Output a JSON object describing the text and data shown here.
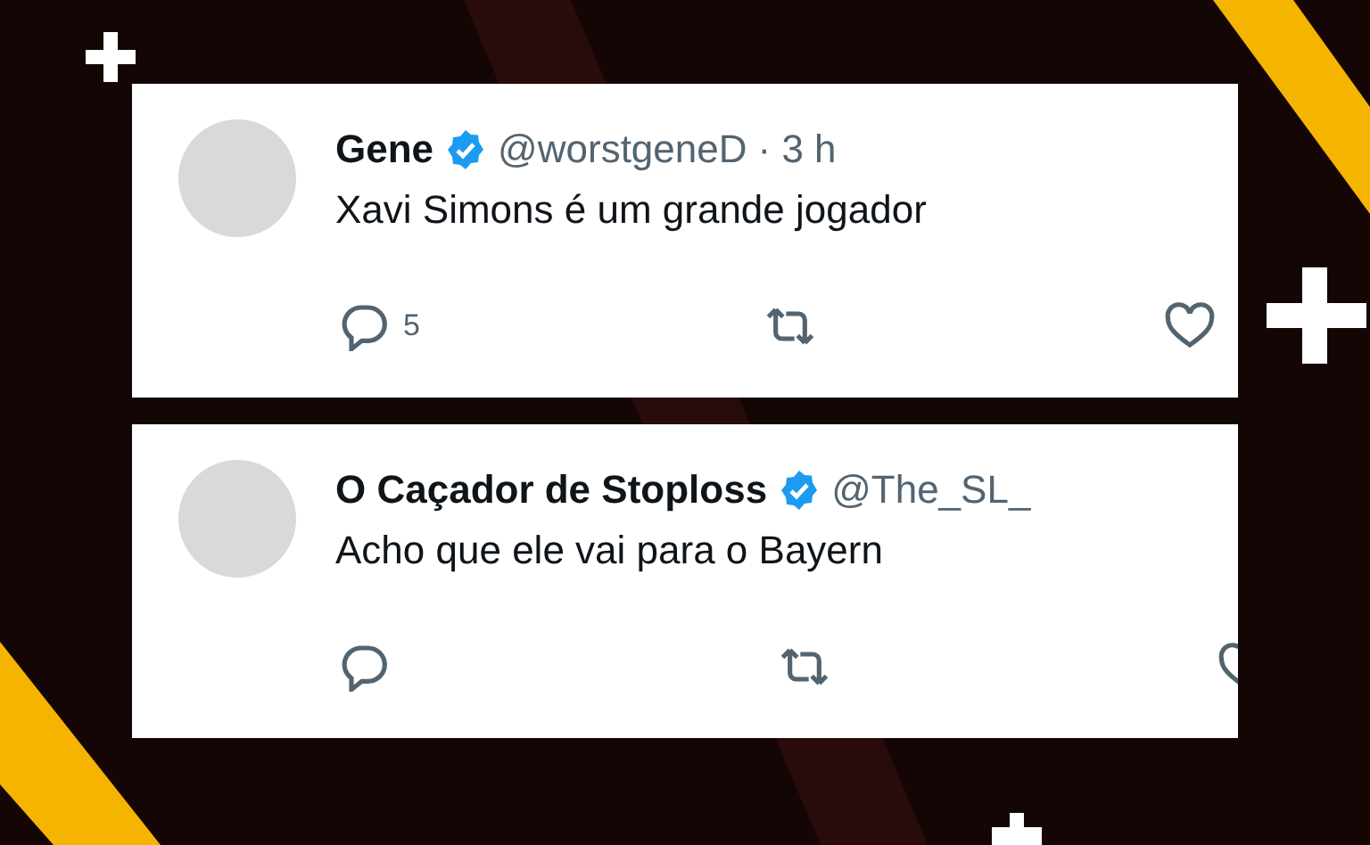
{
  "tweets": [
    {
      "name": "Gene",
      "verified": true,
      "handle": "@worstgeneD",
      "time": "· 3 h",
      "text": "Xavi Simons é um grande jogador",
      "actions": [
        {
          "kind": "reply",
          "count": "5"
        },
        {
          "kind": "retweet"
        },
        {
          "kind": "like"
        }
      ]
    },
    {
      "name": "O Caçador de Stoploss",
      "verified": true,
      "handle": "@The_SL_",
      "text": "Acho que ele vai para o Bayern",
      "actions": [
        {
          "kind": "reply"
        },
        {
          "kind": "retweet"
        },
        {
          "kind": "like"
        }
      ]
    }
  ]
}
